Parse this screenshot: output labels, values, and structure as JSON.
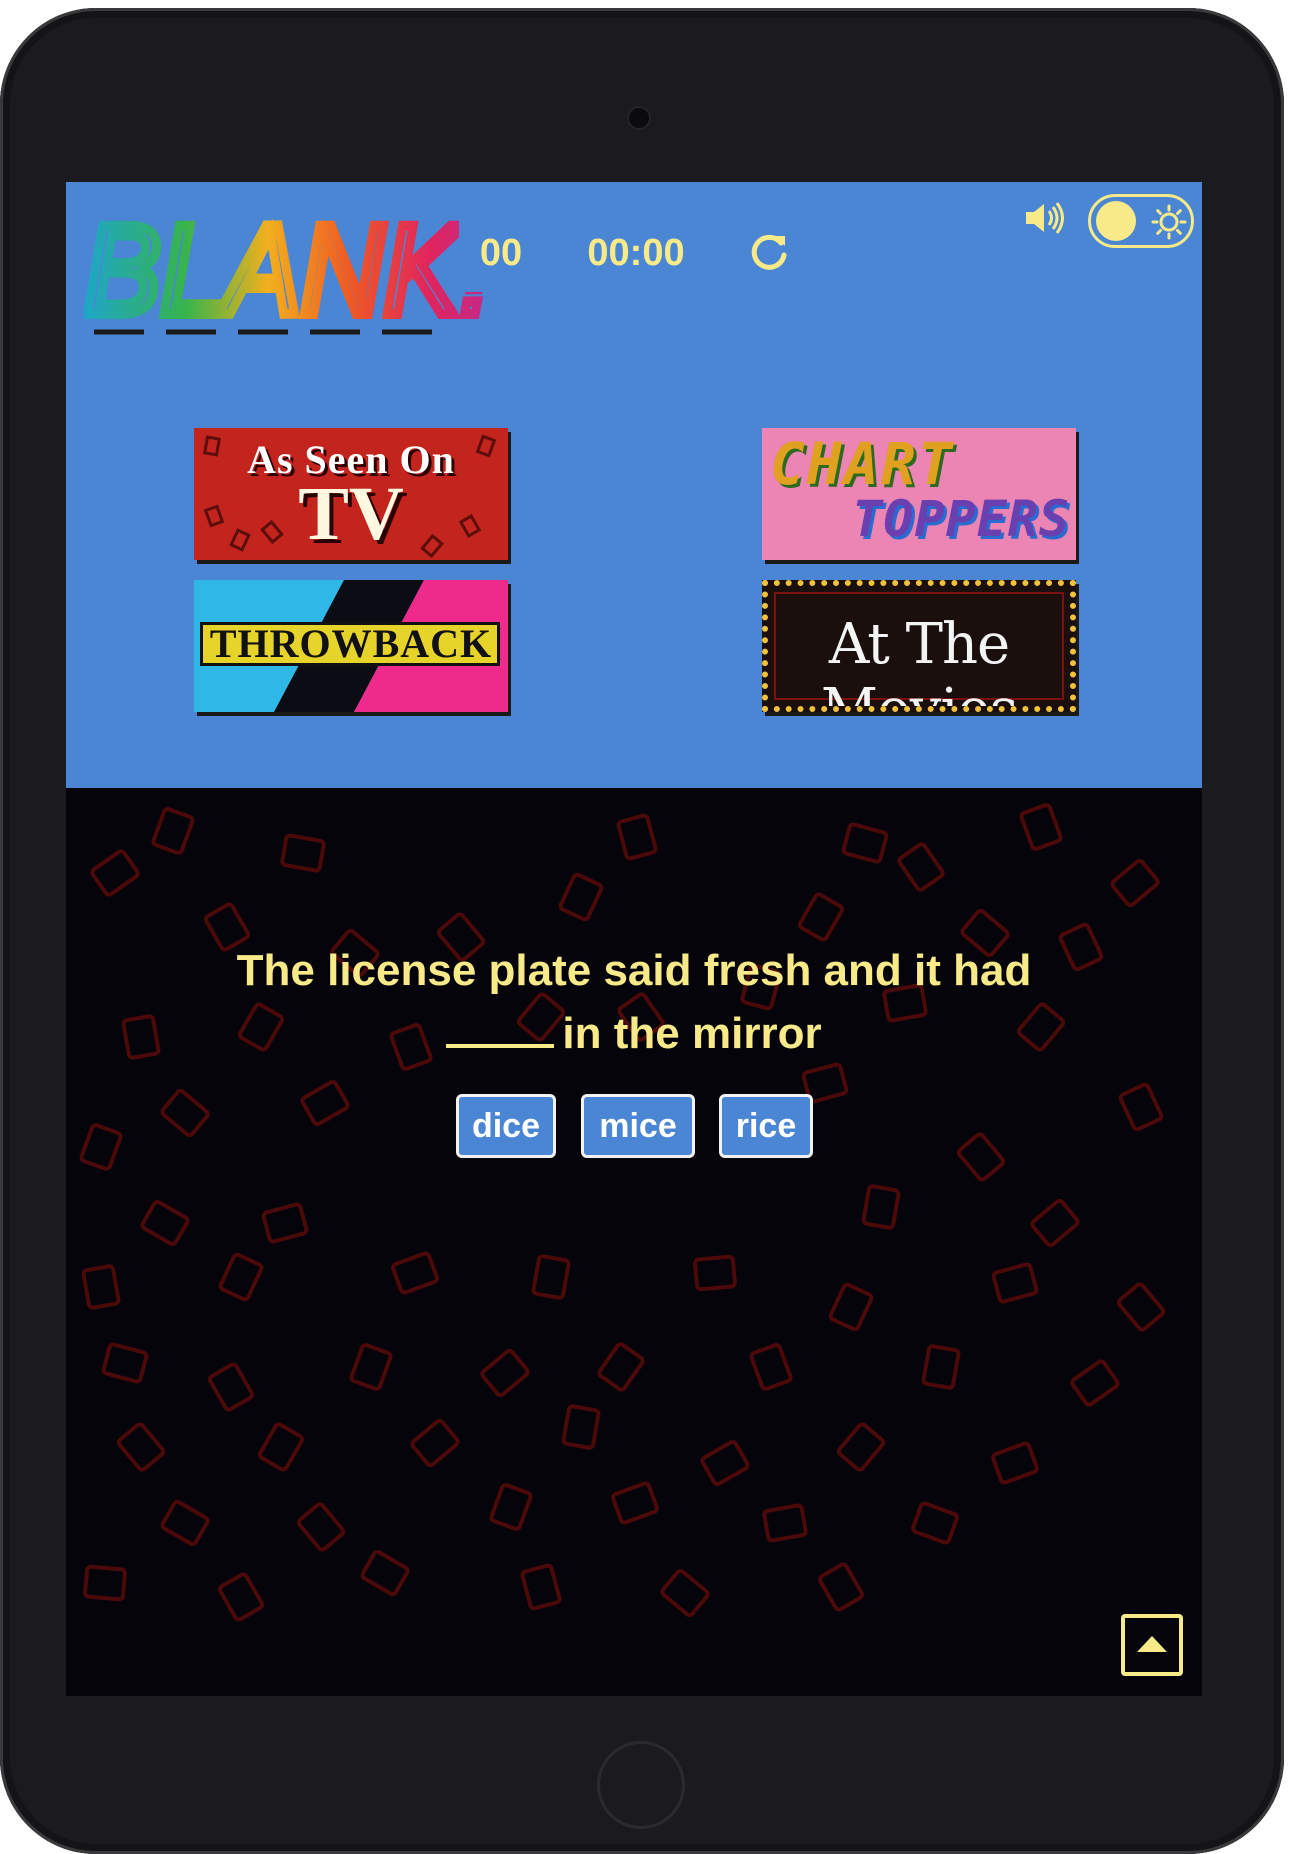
{
  "app": {
    "logo_text": "BLANK!",
    "accent_color": "#4a86d4",
    "text_color": "#f8ea88"
  },
  "header": {
    "sound_icon": "speaker-volume-icon",
    "theme_toggle_icon": "sun-icon"
  },
  "categories": [
    {
      "id": "tv",
      "line1": "As Seen On",
      "line2": "TV"
    },
    {
      "id": "chart",
      "line1": "CHART",
      "line2": "TOPPERS"
    },
    {
      "id": "throwback",
      "label": "THROWBACK"
    },
    {
      "id": "movies",
      "label": "At The Movies"
    }
  ],
  "stats": {
    "score": "00",
    "timer": "00:00",
    "reset_icon": "refresh-icon"
  },
  "question": {
    "before_blank": "The license plate said fresh and it had",
    "after_blank": "in the mirror"
  },
  "answers": [
    "dice",
    "mice",
    "rice"
  ],
  "footer": {
    "scroll_top_icon": "caret-up-icon"
  }
}
